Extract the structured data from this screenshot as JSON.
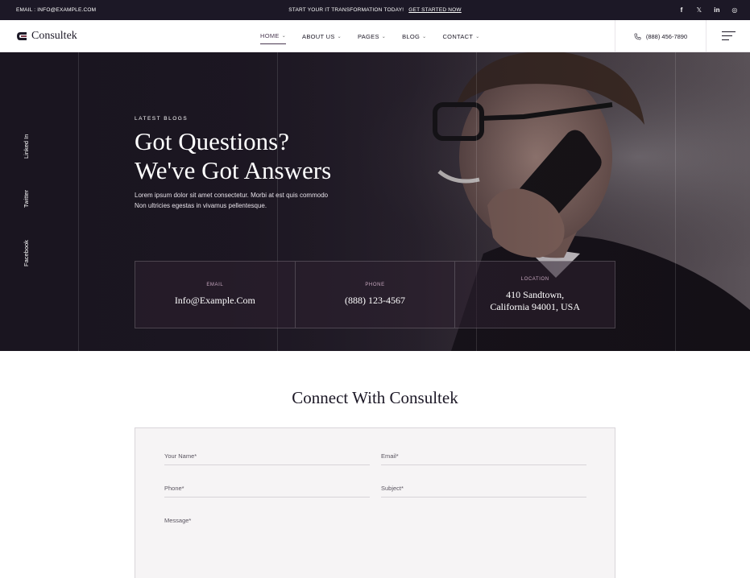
{
  "topbar": {
    "email": "EMAIL : INFO@EXAMPLE.COM",
    "promo_text": "START YOUR IT TRANSFORMATION TODAY!",
    "promo_link": "GET STARTED NOW",
    "social": [
      "f",
      "𝕏",
      "in",
      "◎"
    ]
  },
  "nav": {
    "logo_text": "Consultek",
    "items": [
      {
        "label": "HOME"
      },
      {
        "label": "ABOUT US"
      },
      {
        "label": "PAGES"
      },
      {
        "label": "BLOG"
      },
      {
        "label": "CONTACT"
      }
    ],
    "phone": "(888) 456-7890"
  },
  "hero": {
    "side_social": [
      "Linked In",
      "Twitter",
      "Facebook"
    ],
    "kicker": "LATEST BLOGS",
    "title_line1": "Got Questions?",
    "title_line2": "We've Got Answers",
    "description": "Lorem ipsum dolor sit amet consectetur. Morbi at est quis commodo Non ultricies egestas in vivamus pellentesque.",
    "info": [
      {
        "label": "EMAIL",
        "value": "Info@Example.Com"
      },
      {
        "label": "PHONE",
        "value": "(888) 123-4567"
      },
      {
        "label": "LOCATION",
        "value_line1": "410 Sandtown,",
        "value_line2": "California 94001, USA"
      }
    ]
  },
  "connect": {
    "title": "Connect With Consultek",
    "fields": {
      "name": "Your Name*",
      "email": "Email*",
      "phone": "Phone*",
      "subject": "Subject*",
      "message": "Message*"
    }
  },
  "colors": {
    "dark": "#1c1826",
    "accent": "#4a3a52",
    "form_bg": "#f6f4f5"
  }
}
